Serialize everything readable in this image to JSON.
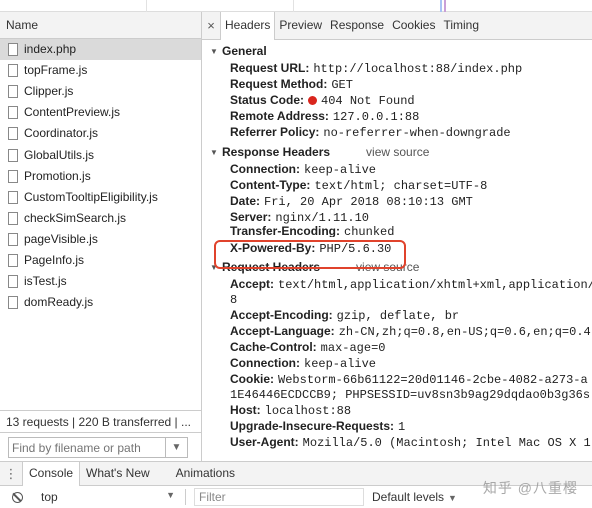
{
  "left_panel": {
    "column_header": "Name",
    "files": [
      {
        "name": "index.php",
        "selected": true
      },
      {
        "name": "topFrame.js"
      },
      {
        "name": "Clipper.js"
      },
      {
        "name": "ContentPreview.js"
      },
      {
        "name": "Coordinator.js"
      },
      {
        "name": "GlobalUtils.js"
      },
      {
        "name": "Promotion.js"
      },
      {
        "name": "CustomTooltipEligibility.js"
      },
      {
        "name": "checkSimSearch.js"
      },
      {
        "name": "pageVisible.js"
      },
      {
        "name": "PageInfo.js"
      },
      {
        "name": "isTest.js"
      },
      {
        "name": "domReady.js"
      }
    ],
    "status": "13 requests | 220 B transferred | ...",
    "filter_placeholder": "Find by filename or path"
  },
  "tabs": {
    "close": "×",
    "items": [
      "Headers",
      "Preview",
      "Response",
      "Cookies",
      "Timing"
    ],
    "active": "Headers"
  },
  "general": {
    "title": "General",
    "rows": [
      {
        "key": "Request URL:",
        "value": "http://localhost:88/index.php"
      },
      {
        "key": "Request Method:",
        "value": "GET"
      },
      {
        "key": "Status Code:",
        "value": "404 Not Found",
        "status_color": "#d9251d"
      },
      {
        "key": "Remote Address:",
        "value": "127.0.0.1:88"
      },
      {
        "key": "Referrer Policy:",
        "value": "no-referrer-when-downgrade"
      }
    ]
  },
  "response_headers": {
    "title": "Response Headers",
    "view_source": "view source",
    "rows": [
      {
        "key": "Connection:",
        "value": "keep-alive"
      },
      {
        "key": "Content-Type:",
        "value": "text/html; charset=UTF-8"
      },
      {
        "key": "Date:",
        "value": "Fri, 20 Apr 2018 08:10:13 GMT"
      },
      {
        "key": "Server:",
        "value": "nginx/1.11.10"
      },
      {
        "key": "Transfer-Encoding:",
        "value": "chunked"
      },
      {
        "key": "X-Powered-By:",
        "value": "PHP/5.6.30",
        "highlighted": true
      }
    ]
  },
  "request_headers": {
    "title": "Request Headers",
    "view_source": "view source",
    "rows": [
      {
        "key": "Accept:",
        "value": "text/html,application/xhtml+xml,application/x",
        "cont": "8"
      },
      {
        "key": "Accept-Encoding:",
        "value": "gzip, deflate, br"
      },
      {
        "key": "Accept-Language:",
        "value": "zh-CN,zh;q=0.8,en-US;q=0.6,en;q=0.4"
      },
      {
        "key": "Cache-Control:",
        "value": "max-age=0"
      },
      {
        "key": "Connection:",
        "value": "keep-alive"
      },
      {
        "key": "Cookie:",
        "value": "Webstorm-66b61122=20d01146-2cbe-4082-a273-a",
        "cont": "1E46446ECDCCB9; PHPSESSID=uv8sn3b9ag29dqdao0b3g36s"
      },
      {
        "key": "Host:",
        "value": "localhost:88"
      },
      {
        "key": "Upgrade-Insecure-Requests:",
        "value": "1"
      },
      {
        "key": "User-Agent:",
        "value": "Mozilla/5.0 (Macintosh; Intel Mac OS X 1"
      }
    ]
  },
  "drawer": {
    "menu_icon": "⋮",
    "tabs": [
      "Console",
      "What's New",
      "Animations"
    ],
    "active": "Console",
    "context": "top",
    "filter_placeholder": "Filter",
    "levels": "Default levels"
  },
  "watermark": "知乎 @八重樱",
  "colors": {
    "highlight_border": "#e0432c",
    "status_dot": "#d9251d"
  }
}
